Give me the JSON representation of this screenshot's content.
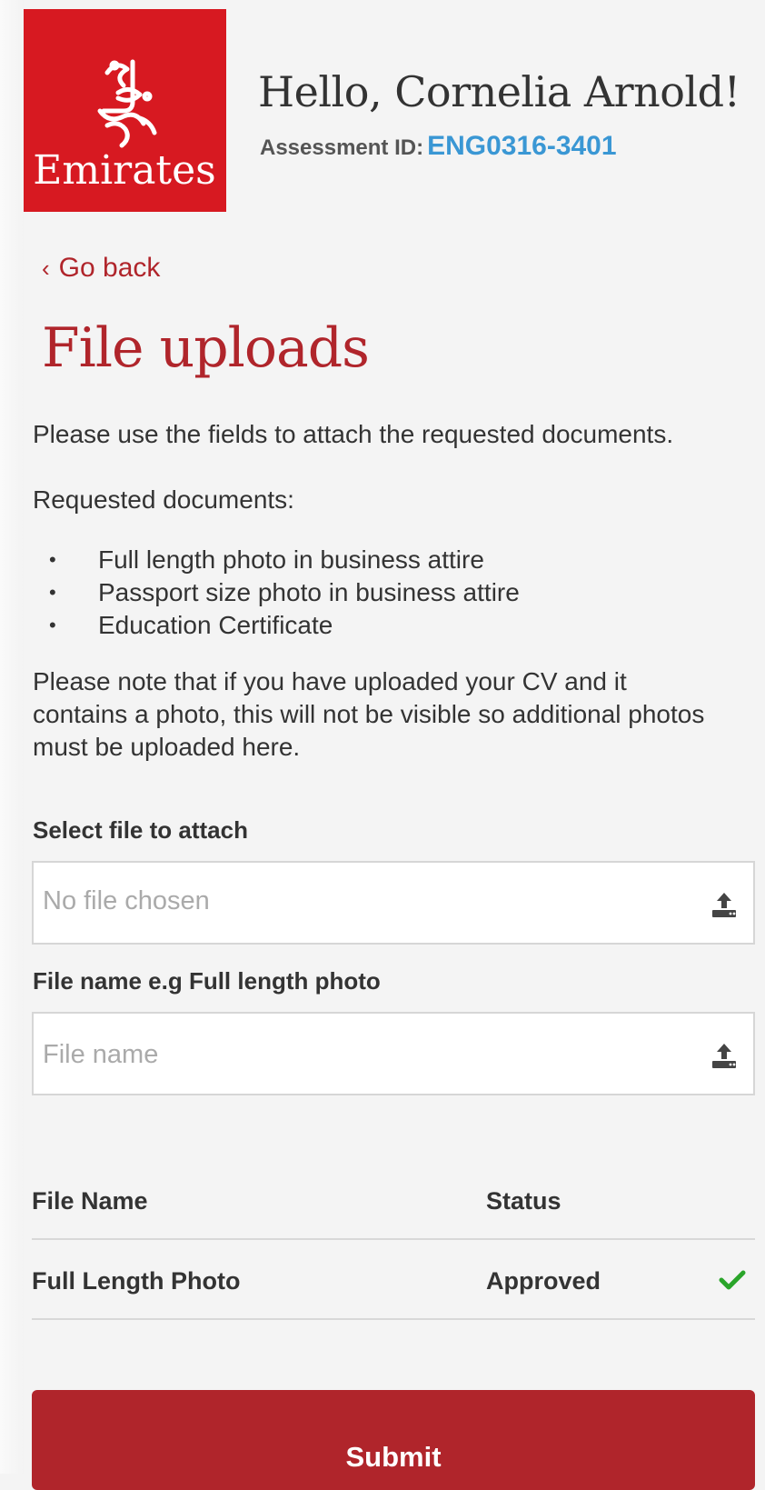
{
  "header": {
    "logo_text": "Emirates",
    "greeting": "Hello, Cornelia Arnold!",
    "assessment_label": "Assessment ID:",
    "assessment_id": "ENG0316-3401"
  },
  "nav": {
    "back_label": "Go back"
  },
  "main": {
    "title": "File uploads",
    "intro": "Please use the fields to attach the requested documents.",
    "requested_label": "Requested documents:",
    "requested_documents": [
      "Full length photo in business attire",
      "Passport size photo in business attire",
      "Education Certificate"
    ],
    "note": "Please note that if you have uploaded your CV and it contains a photo, this will not be visible so additional photos must be uploaded here."
  },
  "form": {
    "file_label": "Select file to attach",
    "file_placeholder": "No file chosen",
    "name_label": "File name e.g Full length photo",
    "name_placeholder": "File name"
  },
  "table": {
    "headers": [
      "File Name",
      "Status"
    ],
    "rows": [
      {
        "name": "Full Length Photo",
        "status": "Approved"
      }
    ]
  },
  "actions": {
    "submit_label": "Submit"
  },
  "colors": {
    "brand_red": "#d71921",
    "accent_red": "#b0252b",
    "link_blue": "#3a97d4",
    "success_green": "#2aa52a"
  },
  "icons": {
    "upload": "upload-icon",
    "approved": "check-icon",
    "back": "chevron-left-icon"
  }
}
